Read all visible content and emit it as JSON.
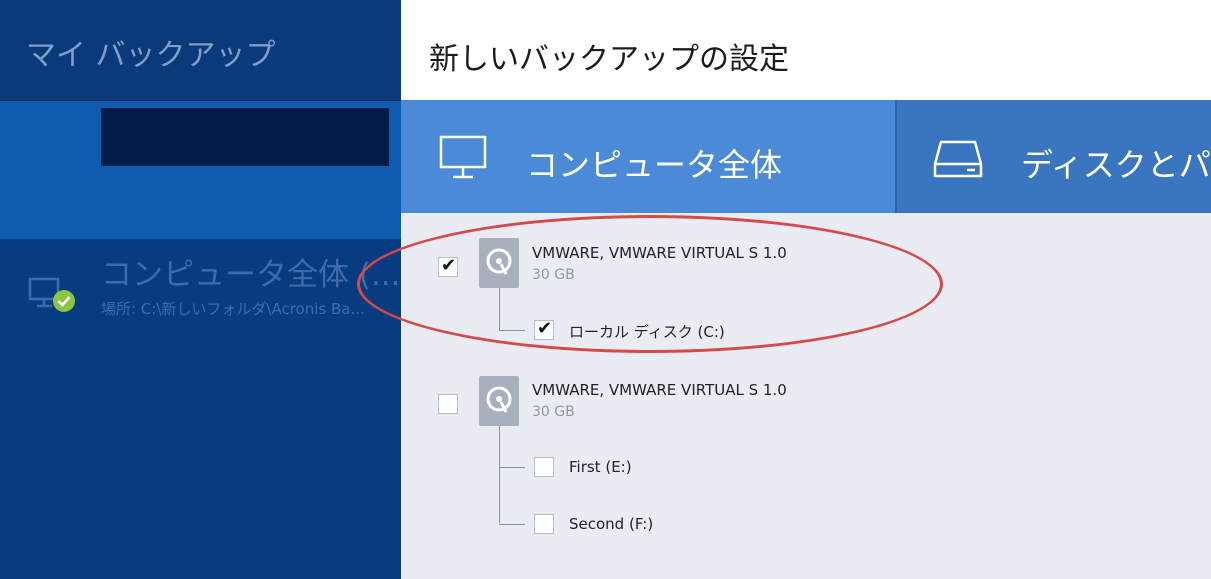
{
  "sidebar": {
    "title": "マイ バックアップ",
    "backup_item": {
      "title": "コンピュータ全体 (...",
      "subtitle": "場所: C:\\新しいフォルダ\\Acronis Ba..."
    }
  },
  "main": {
    "title": "新しいバックアップの設定"
  },
  "tabs": [
    {
      "label": "コンピュータ全体",
      "icon": "monitor-icon"
    },
    {
      "label": "ディスクとパー",
      "icon": "drive-icon"
    }
  ],
  "disks": [
    {
      "name": "VMWARE, VMWARE VIRTUAL S 1.0",
      "size": "30 GB",
      "checked": true,
      "partitions": [
        {
          "label": "ローカル ディスク (C:)",
          "checked": true
        }
      ]
    },
    {
      "name": "VMWARE, VMWARE VIRTUAL S 1.0",
      "size": "30 GB",
      "checked": false,
      "partitions": [
        {
          "label": "First (E:)",
          "checked": false
        },
        {
          "label": "Second (F:)",
          "checked": false
        }
      ]
    }
  ],
  "colors": {
    "sidebar": "#083c80",
    "sidebar_selected": "#0e5bb0",
    "tab_active": "#4a8ad6",
    "highlight_ellipse": "#d94848",
    "status_ok": "#8cc63f"
  }
}
